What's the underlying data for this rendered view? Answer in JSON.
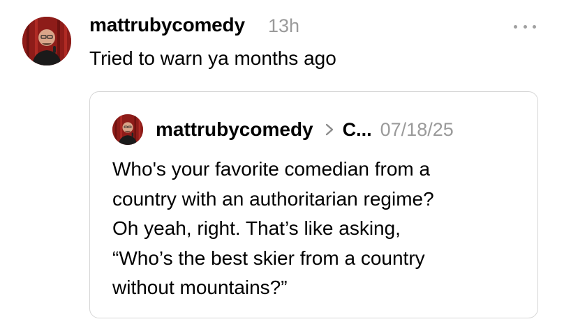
{
  "post": {
    "username": "mattrubycomedy",
    "time": "13h",
    "text": "Tried to warn ya months ago",
    "more_icon": "more-horizontal-icon"
  },
  "quote": {
    "username": "mattrubycomedy",
    "context": "C...",
    "date": "07/18/25",
    "chevron_icon": "chevron-right-icon",
    "lines": [
      "Who's your favorite comedian from a",
      "country with an authoritarian regime?",
      "Oh yeah, right. That’s like asking,",
      "“Who’s the best skier from a country",
      "without mountains?”"
    ]
  },
  "colors": {
    "text": "#000000",
    "muted": "#9a9a9a",
    "border": "#d6d6d6",
    "avatar_bg": "#8a1a18"
  }
}
